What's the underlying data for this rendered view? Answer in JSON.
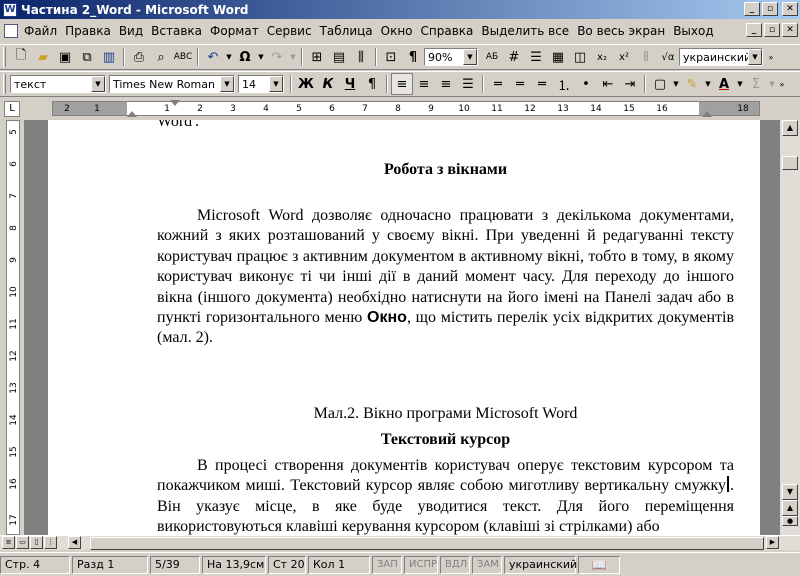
{
  "window": {
    "title": "Частина 2_Word - Microsoft Word",
    "minimize": "_",
    "restore": "▫",
    "close": "✕"
  },
  "menu": [
    "Файл",
    "Правка",
    "Вид",
    "Вставка",
    "Формат",
    "Сервис",
    "Таблица",
    "Окно",
    "Справка",
    "Выделить все",
    "Во весь экран",
    "Выход"
  ],
  "toolbar1": {
    "zoom": "90%",
    "language": "украинский",
    "undo_glyph": "↶",
    "redo_glyph": "↷",
    "omega": "Ω"
  },
  "toolbar2": {
    "style": "текст",
    "font": "Times New Roman",
    "size": "14",
    "bold": "Ж",
    "italic": "К",
    "underline": "Ч"
  },
  "ruler_h": [
    "2",
    "1",
    "1",
    "2",
    "3",
    "4",
    "5",
    "6",
    "7",
    "8",
    "9",
    "10",
    "11",
    "12",
    "13",
    "14",
    "15",
    "16",
    "18"
  ],
  "ruler_v": [
    "5",
    "6",
    "7",
    "8",
    "9",
    "10",
    "11",
    "12",
    "13",
    "14",
    "15",
    "16",
    "17"
  ],
  "document": {
    "cut_line": "Word'.",
    "heading1": "Робота з вікнами",
    "para1_text": "Microsoft Word дозволяє одночасно працювати з декількома документами, кожний з яких розташований у своєму вікні. При уведенні й редагуванні тексту користувач працює з активним документом в активному вікні, тобто в тому, в якому користувач виконує ті чи інші дії в даний момент часу. Для переходу до іншого вікна (іншого документа)  необхідно натиснути на його імені на Панелі задач або в пункті горизонтального меню ",
    "para1_bold": "Окно",
    "para1_end": ", що містить перелік усіх відкритих документів (мал. 2).",
    "caption": "Мал.2. Вікно програми Microsoft Word",
    "heading2": "Текстовий курсор",
    "para2_text_a": "В процесі створення документів користувач оперує текстовим курсором та  покажчиком миші. Текстовий курсор являє собою миготливу вертикальну смужку",
    "para2_text_b": ". Він указує місце, в яке буде уводитися текст. Для його переміщення використовуються клавіші керування курсором (клавіші зі стрілками) або"
  },
  "status": {
    "page": "Стр. 4",
    "section": "Разд 1",
    "pages": "5/39",
    "at": "На 13,9см",
    "line": "Ст 20",
    "col": "Кол 1",
    "rec": "ЗАП",
    "trk": "ИСПР",
    "ext": "ВДЛ",
    "ovr": "ЗАМ",
    "lang": "украинский"
  }
}
